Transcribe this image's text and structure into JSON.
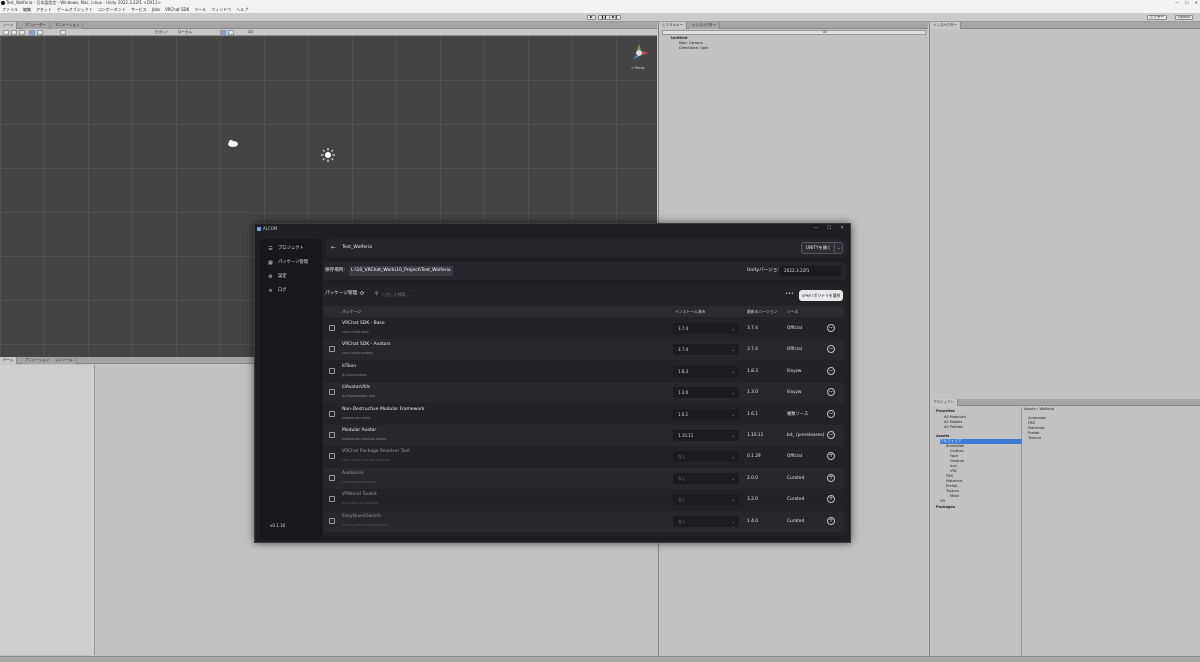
{
  "unity": {
    "window_title": "Test_Wolferia - 日本語設定 - Windows, Mac, Linux - Unity 2022.3.22f1 <DX11>",
    "window_controls": [
      "—",
      "☐",
      "✕"
    ],
    "menu": [
      "ファイル",
      "編集",
      "アセット",
      "ゲームオブジェクト",
      "コンポーネント",
      "サービス",
      "Jobs",
      "VRChat SDK",
      "ツール",
      "ウィンドウ",
      "ヘルプ"
    ],
    "toolbar": {
      "play": "▶",
      "pause": "❚❚",
      "step": "▶❚",
      "layers": "レイヤー",
      "layout": "Layout"
    },
    "tabs": {
      "scene": "シーン",
      "animator": "アニメーター",
      "animation": "アニメーション",
      "hierarchy": "ヒエラルキー",
      "inspector_top": "インスペクター",
      "inspector": "インスペクター",
      "game": "ゲーム",
      "animation2": "アニメーション",
      "console": "コンソール",
      "project": "プロジェクト"
    },
    "scene_toolbar": {
      "persp": "< Persp",
      "pivot": "ピボット",
      "local": "ローカル",
      "view_mode": "2D"
    },
    "hierarchy": {
      "search_placeholder": "All",
      "scene": "Untitled",
      "items": [
        "Main Camera",
        "Directional Light"
      ]
    },
    "project_tree": {
      "favorites_title": "Favorites",
      "favorites": [
        "All Materials",
        "All Models",
        "All Prefabs"
      ],
      "assets_title": "Assets",
      "assets_tree": [
        "ウルフェリア",
        "Animation",
        "Clothes",
        "Face",
        "Gesture",
        "Icon",
        "VRC",
        "FBX",
        "Materials",
        "Prefab",
        "Texture",
        "Mask",
        "VR"
      ],
      "packages_title": "Packages",
      "breadcrumb": [
        "Assets",
        "Wolferia"
      ],
      "folder_items": [
        "Animation",
        "FBX",
        "Materials",
        "Prefab",
        "Texture"
      ]
    }
  },
  "alcom": {
    "title": "ALCOM",
    "window_controls": [
      "—",
      "☐",
      "✕"
    ],
    "sidebar": {
      "items": [
        {
          "icon": "☰",
          "label": "プロジェクト"
        },
        {
          "icon": "▦",
          "label": "パッケージ管理"
        },
        {
          "icon": "⚙",
          "label": "設定"
        },
        {
          "icon": "≡",
          "label": "ログ"
        }
      ],
      "version": "v0.1.16"
    },
    "project": {
      "name": "Test_Wolferia",
      "open_button": "UNITYを開く",
      "location_label": "保存場所:",
      "location_path": "L:\\10_VRChat_Work\\10_Project\\Test_Wolferia",
      "unity_version_label": "Unityバージョン:",
      "unity_version": "2022.3.22f1"
    },
    "packages": {
      "title": "パッケージ管理",
      "search_placeholder": "入力して検索...",
      "more": "•••",
      "vpm_button": "VPMリポジトリを選択",
      "columns": [
        "パッケージ",
        "インストール済み",
        "最新のバージョン",
        "ソース"
      ],
      "rows": [
        {
          "name": "VRChat SDK - Base",
          "id": "com.vrchat.base",
          "installed": "3.7.4",
          "latest": "3.7.4",
          "source": "Official",
          "action": "−",
          "dim": false
        },
        {
          "name": "VRChat SDK - Avatars",
          "id": "com.vrchat.avatars",
          "installed": "3.7.4",
          "latest": "3.7.4",
          "source": "Official",
          "action": "−",
          "dim": false
        },
        {
          "name": "lilToon",
          "id": "jp.lilxyzw.liltoon",
          "installed": "1.8.3",
          "latest": "1.8.3",
          "source": "lilxyzw",
          "action": "−",
          "dim": false
        },
        {
          "name": "lilAvatarUtils",
          "id": "jp.lilxyzw.avatar-utils",
          "installed": "1.3.0",
          "latest": "1.3.0",
          "source": "lilxyzw",
          "action": "−",
          "dim": false
        },
        {
          "name": "Non-Destructive Modular Framework",
          "id": "nadena.dev.ndmf",
          "installed": "1.6.1",
          "latest": "1.6.1",
          "source": "複数ソース",
          "action": "−",
          "dim": false
        },
        {
          "name": "Modular Avatar",
          "id": "nadena.dev.modular-avatar",
          "installed": "1.10.11",
          "latest": "1.10.11",
          "source": "bd_ (prereleases)",
          "action": "−",
          "dim": false
        },
        {
          "name": "VRChat Package Resolver Tool",
          "id": "com.vrchat.core.vpm-resolver",
          "installed": "なし",
          "latest": "0.1.29",
          "source": "Official",
          "action": "+",
          "dim": true
        },
        {
          "name": "AudioLink",
          "id": "com.llealloo.audiolink",
          "installed": "なし",
          "latest": "2.0.0",
          "source": "Curated",
          "action": "+",
          "dim": true
        },
        {
          "name": "VRWorld Toolkit",
          "id": "dev.vrchat.worldtoolkit",
          "installed": "なし",
          "latest": "3.2.0",
          "source": "Curated",
          "action": "+",
          "dim": true
        },
        {
          "name": "EasyQuestSwitch",
          "id": "vrchat.jordo.easyquestswitch",
          "installed": "なし",
          "latest": "1.4.0",
          "source": "Curated",
          "action": "+",
          "dim": true
        }
      ]
    }
  }
}
